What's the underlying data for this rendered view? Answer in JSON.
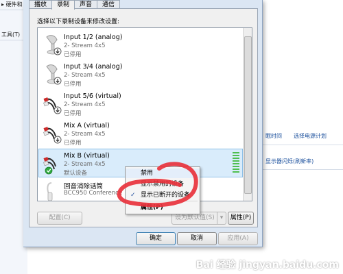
{
  "background": {
    "breadcrumb": "硬件和",
    "tools_menu": "工具(T)",
    "links": [
      "眠时间",
      "选择电源计划",
      "显示器闪烁(刷新率)"
    ]
  },
  "dialog": {
    "tabs": [
      "播放",
      "录制",
      "声音",
      "通信"
    ],
    "active_tab": "录制",
    "instruction": "选择以下录制设备来修改设置:",
    "devices": [
      {
        "name": "Input 1/2 (analog)",
        "sub": "2- Stream 4x5",
        "status": "已停用",
        "icon": "microphone-icon"
      },
      {
        "name": "Input 3/4 (analog)",
        "sub": "2- Stream 4x5",
        "status": "已停用",
        "icon": "microphone-icon"
      },
      {
        "name": "Input 5/6 (virtual)",
        "sub": "2- Stream 4x5",
        "status": "已停用",
        "icon": "rca-cable-icon"
      },
      {
        "name": "Mix A (virtual)",
        "sub": "2- Stream 4x5",
        "status": "已停用",
        "icon": "rca-cable-icon"
      },
      {
        "name": "Mix B (virtual)",
        "sub": "2- Stream 4x5",
        "status": "默认设备",
        "icon": "rca-cable-icon",
        "default_badge": "green-check-icon"
      },
      {
        "name": "回音消除话筒",
        "sub": "BCC950 Conference",
        "status": "",
        "icon": "headset-microphone-icon"
      }
    ],
    "buttons": {
      "configure": "配置(C)",
      "set_default": "设为默认值(S)",
      "properties": "属性(P)",
      "ok": "确定",
      "cancel": "取消",
      "apply": "应用(A)"
    }
  },
  "context_menu": {
    "items": [
      {
        "label": "禁用",
        "checked": false
      },
      {
        "label": "显示禁用的设备",
        "checked": false
      },
      {
        "label": "显示已断开的设备",
        "checked": true
      },
      {
        "label": "属性(P)",
        "checked": false
      }
    ]
  },
  "watermark": "Bai 经验 jingyan.baidu.com",
  "colors": {
    "selection": "#d9ecfb",
    "meter": "#4fbf4f",
    "annotation": "#e8323c"
  }
}
